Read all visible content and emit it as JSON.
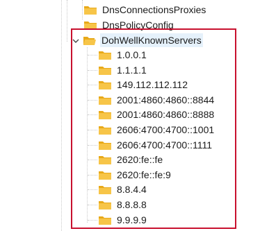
{
  "tree": {
    "siblings_above": [
      {
        "label": "DnsConnectionsProxies",
        "icon": "folder-icon"
      },
      {
        "label": "DnsPolicyConfig",
        "icon": "folder-icon"
      }
    ],
    "expanded_node": {
      "label": "DohWellKnownServers",
      "icon": "folder-icon",
      "state": "expanded",
      "children": [
        {
          "label": "1.0.0.1"
        },
        {
          "label": "1.1.1.1"
        },
        {
          "label": "149.112.112.112"
        },
        {
          "label": "2001:4860:4860::8844"
        },
        {
          "label": "2001:4860:4860::8888"
        },
        {
          "label": "2606:4700:4700::1001"
        },
        {
          "label": "2606:4700:4700::1111"
        },
        {
          "label": "2620:fe::fe"
        },
        {
          "label": "2620:fe::fe:9"
        },
        {
          "label": "8.8.4.4"
        },
        {
          "label": "8.8.8.8"
        },
        {
          "label": "9.9.9.9"
        }
      ]
    }
  },
  "colors": {
    "folder_fill": "#f7c548",
    "folder_tab": "#e8a919",
    "highlight_border": "#c8102e"
  }
}
